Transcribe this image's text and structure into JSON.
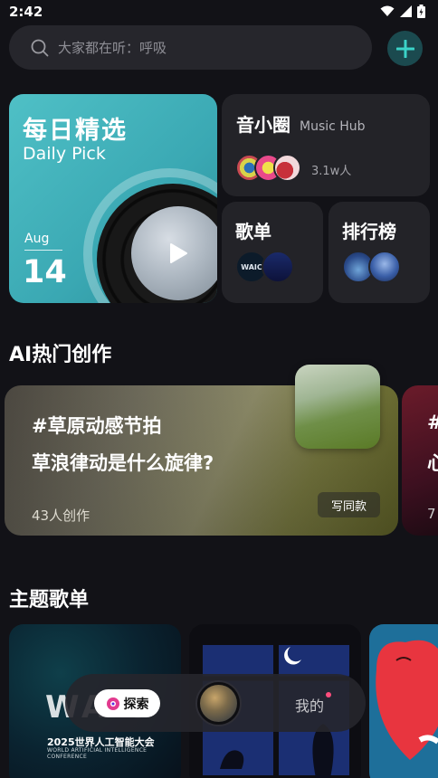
{
  "status": {
    "time": "2:42"
  },
  "search": {
    "placeholder": "大家都在听：呼吸"
  },
  "daily_pick": {
    "title": "每日精选",
    "subtitle": "Daily Pick",
    "month": "Aug",
    "day": "14"
  },
  "music_hub": {
    "title": "音小圈",
    "subtitle": "Music Hub",
    "listeners": "3.1w人"
  },
  "playlists_card": {
    "title": "歌单",
    "thumb_text": "WAIC"
  },
  "charts_card": {
    "title": "排行榜"
  },
  "ai_section": {
    "title": "AI热门创作",
    "cards": [
      {
        "tag": "#草原动感节拍",
        "question": "草浪律动是什么旋律?",
        "count": "43人创作",
        "button": "写同款"
      },
      {
        "tag": "#",
        "question": "心",
        "count": "7"
      }
    ]
  },
  "theme_section": {
    "title": "主题歌单",
    "cards": [
      {
        "logo_text": "WAIC",
        "title": "2025世界人工智能大会",
        "subtitle": "WORLD ARTIFICIAL INTELLIGENCE CONFERENCE"
      },
      {},
      {}
    ]
  },
  "bottom_nav": {
    "explore": "探索",
    "mine": "我的"
  },
  "colors": {
    "accent": "#3bd3c8",
    "background": "#121217",
    "card": "#232328",
    "badge": "#ff4d7d"
  }
}
